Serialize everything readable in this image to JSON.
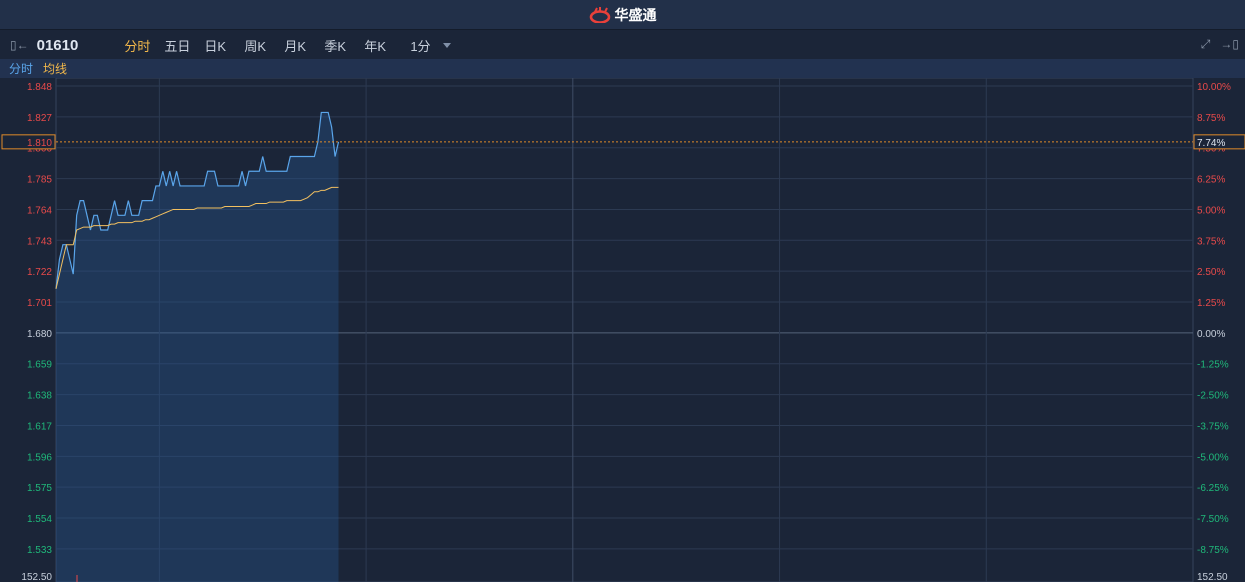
{
  "app": {
    "title": "华盛通"
  },
  "toolbar": {
    "code": "01610",
    "tabs": [
      "分时",
      "五日",
      "日K",
      "周K",
      "月K",
      "季K",
      "年K"
    ],
    "active_tab": "分时",
    "period": "1分"
  },
  "legend": {
    "price": "分时",
    "avg": "均线"
  },
  "colors": {
    "up": "#e84a4a",
    "down": "#1fb87a",
    "price": "#5aa5ea",
    "avg": "#f2c060",
    "accent": "#e08a2a"
  },
  "chart_data": {
    "type": "line",
    "prev_close": 1.68,
    "current_price": "1.810",
    "current_pct": "7.74%",
    "ylim": [
      1.512,
      1.848
    ],
    "left_ticks": [
      "1.848",
      "1.827",
      "1.806",
      "1.785",
      "1.764",
      "1.743",
      "1.722",
      "1.701",
      "1.680",
      "1.659",
      "1.638",
      "1.617",
      "1.596",
      "1.575",
      "1.554",
      "1.533"
    ],
    "right_ticks": [
      "10.00%",
      "8.75%",
      "7.50%",
      "6.25%",
      "5.00%",
      "3.75%",
      "2.50%",
      "1.25%",
      "0.00%",
      "-1.25%",
      "-2.50%",
      "-3.75%",
      "-5.00%",
      "-6.25%",
      "-7.50%",
      "-8.75%"
    ],
    "volume_label": "152.50",
    "total_minutes": 330,
    "series": [
      {
        "name": "分时",
        "values": [
          1.71,
          1.73,
          1.74,
          1.74,
          1.73,
          1.72,
          1.76,
          1.77,
          1.77,
          1.76,
          1.75,
          1.76,
          1.76,
          1.75,
          1.75,
          1.75,
          1.76,
          1.77,
          1.76,
          1.76,
          1.76,
          1.77,
          1.76,
          1.76,
          1.76,
          1.77,
          1.77,
          1.77,
          1.77,
          1.78,
          1.78,
          1.79,
          1.78,
          1.79,
          1.78,
          1.79,
          1.78,
          1.78,
          1.78,
          1.78,
          1.78,
          1.78,
          1.78,
          1.78,
          1.79,
          1.79,
          1.79,
          1.78,
          1.78,
          1.78,
          1.78,
          1.78,
          1.78,
          1.78,
          1.79,
          1.78,
          1.79,
          1.79,
          1.79,
          1.79,
          1.8,
          1.79,
          1.79,
          1.79,
          1.79,
          1.79,
          1.79,
          1.79,
          1.8,
          1.8,
          1.8,
          1.8,
          1.8,
          1.8,
          1.8,
          1.8,
          1.81,
          1.83,
          1.83,
          1.83,
          1.82,
          1.8,
          1.81
        ]
      },
      {
        "name": "均线",
        "values": [
          1.71,
          1.72,
          1.73,
          1.74,
          1.74,
          1.74,
          1.75,
          1.751,
          1.752,
          1.752,
          1.752,
          1.753,
          1.753,
          1.753,
          1.753,
          1.753,
          1.754,
          1.754,
          1.755,
          1.755,
          1.755,
          1.755,
          1.755,
          1.756,
          1.756,
          1.756,
          1.757,
          1.757,
          1.758,
          1.759,
          1.76,
          1.761,
          1.762,
          1.763,
          1.764,
          1.764,
          1.764,
          1.764,
          1.764,
          1.764,
          1.764,
          1.765,
          1.765,
          1.765,
          1.765,
          1.765,
          1.765,
          1.765,
          1.765,
          1.766,
          1.766,
          1.766,
          1.766,
          1.766,
          1.766,
          1.766,
          1.766,
          1.767,
          1.768,
          1.768,
          1.768,
          1.768,
          1.769,
          1.769,
          1.769,
          1.769,
          1.769,
          1.77,
          1.77,
          1.77,
          1.77,
          1.77,
          1.771,
          1.772,
          1.774,
          1.776,
          1.776,
          1.777,
          1.777,
          1.778,
          1.779,
          1.779,
          1.779
        ]
      }
    ]
  }
}
